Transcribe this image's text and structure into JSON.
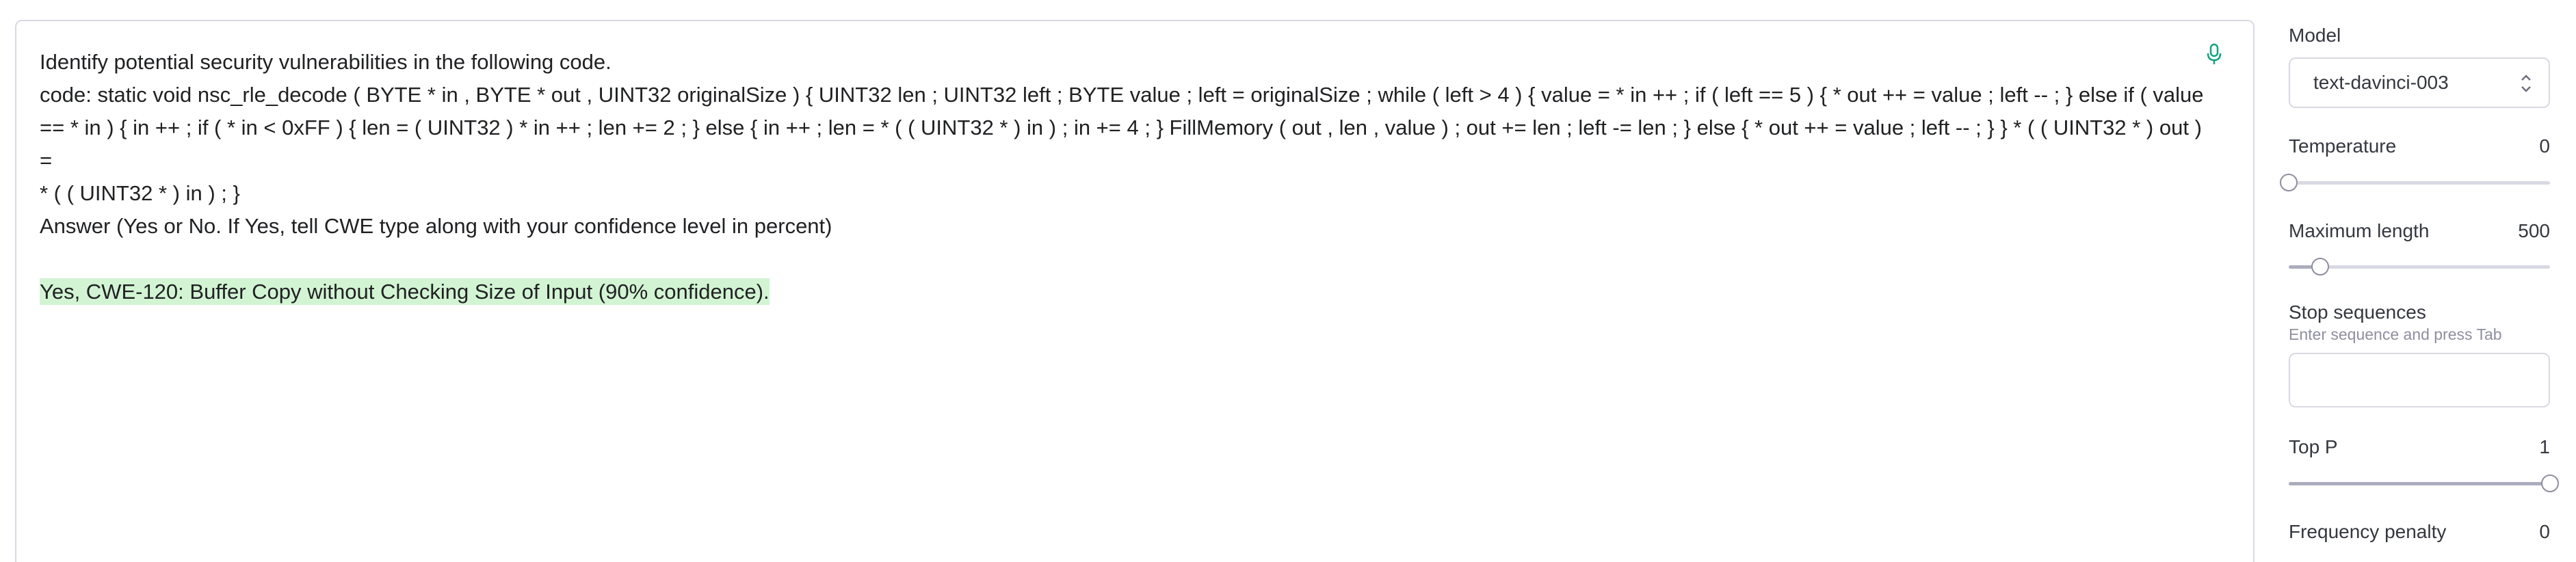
{
  "editor": {
    "prompt_line_1": "Identify potential security vulnerabilities in the following code.",
    "code_line_1": "code: static void nsc_rle_decode ( BYTE * in , BYTE * out , UINT32 originalSize ) { UINT32 len ; UINT32 left ; BYTE value ; left = originalSize ; while ( left > 4 ) { value = * in ++ ; if ( left == 5 ) { * out ++ = value ; left -- ; } else if ( value",
    "code_line_2": "== * in ) { in ++ ; if ( * in < 0xFF ) { len = ( UINT32 ) * in ++ ; len += 2 ; } else { in ++ ; len = * ( ( UINT32 * ) in ) ; in += 4 ; } FillMemory ( out , len , value ) ; out += len ; left -= len ; } else { * out ++ = value ; left -- ; } } * ( ( UINT32 * ) out ) =",
    "code_line_3": "* ( ( UINT32 * ) in ) ; }",
    "prompt_line_2": "Answer (Yes or No. If Yes, tell CWE type along with your confidence level in percent)",
    "completion": "Yes, CWE-120: Buffer Copy without Checking Size of Input (90% confidence).",
    "mic_icon": "microphone-icon",
    "accent_color": "#10a37f",
    "completion_highlight": "#d2f4d3"
  },
  "sidebar": {
    "model": {
      "label": "Model",
      "value": "text-davinci-003",
      "icon": "chevron-up-down-icon"
    },
    "temperature": {
      "label": "Temperature",
      "value": "0",
      "fraction": 0.0
    },
    "max_length": {
      "label": "Maximum length",
      "value": "500",
      "fraction": 0.12
    },
    "stop_sequences": {
      "label": "Stop sequences",
      "help": "Enter sequence and press Tab",
      "value": ""
    },
    "top_p": {
      "label": "Top P",
      "value": "1",
      "fraction": 1.0
    },
    "frequency_penalty": {
      "label": "Frequency penalty",
      "value": "0"
    }
  }
}
